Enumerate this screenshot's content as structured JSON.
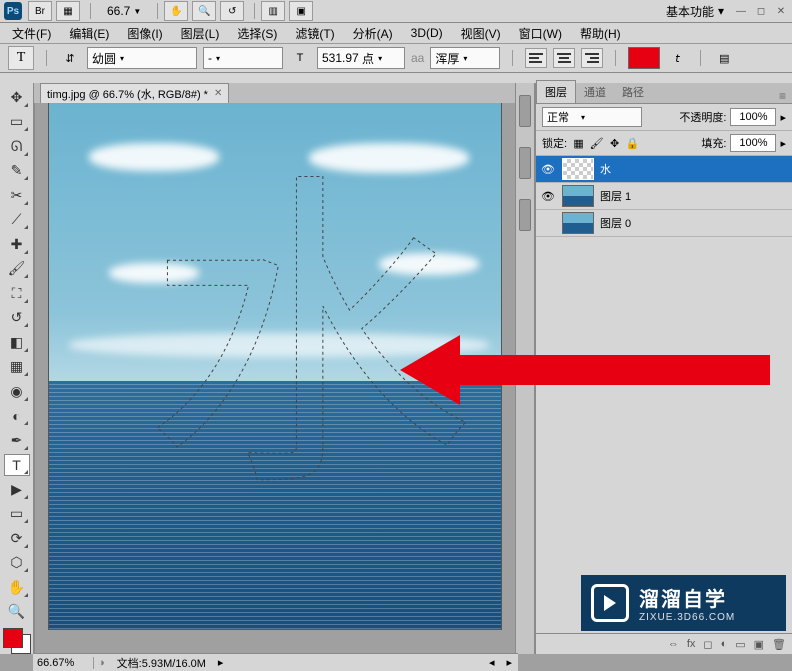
{
  "app": {
    "title_zoom": "66.7",
    "workspace_label": "基本功能"
  },
  "menu": {
    "file": "文件(F)",
    "edit": "编辑(E)",
    "image": "图像(I)",
    "layer": "图层(L)",
    "select": "选择(S)",
    "filter": "滤镜(T)",
    "analysis": "分析(A)",
    "three_d": "3D(D)",
    "view": "视图(V)",
    "window": "窗口(W)",
    "help": "帮助(H)"
  },
  "options": {
    "tool_glyph": "T",
    "font_family": "幼圆",
    "font_style": "-",
    "font_size_value": "531.97",
    "font_size_unit": "点",
    "aa_prefix": "aa",
    "aa_value": "浑厚",
    "color_hex": "#e60012"
  },
  "document": {
    "tab_label": "timg.jpg @ 66.7% (水, RGB/8#) *",
    "selection_glyph": "水"
  },
  "panels": {
    "layers_tab": "图层",
    "channels_tab": "通道",
    "paths_tab": "路径",
    "blend_mode": "正常",
    "opacity_label": "不透明度:",
    "opacity_value": "100%",
    "lock_label": "锁定:",
    "fill_label": "填充:",
    "fill_value": "100%",
    "layers": [
      {
        "name": "水",
        "thumb": "checker",
        "visible": true,
        "selected": true
      },
      {
        "name": "图层 1",
        "thumb": "sea",
        "visible": true,
        "selected": false
      },
      {
        "name": "图层 0",
        "thumb": "sea",
        "visible": false,
        "selected": false
      }
    ]
  },
  "status": {
    "zoom": "66.67%",
    "doc_info": "文档:5.93M/16.0M"
  },
  "watermark": {
    "main": "溜溜自学",
    "sub": "ZIXUE.3D66.COM"
  }
}
